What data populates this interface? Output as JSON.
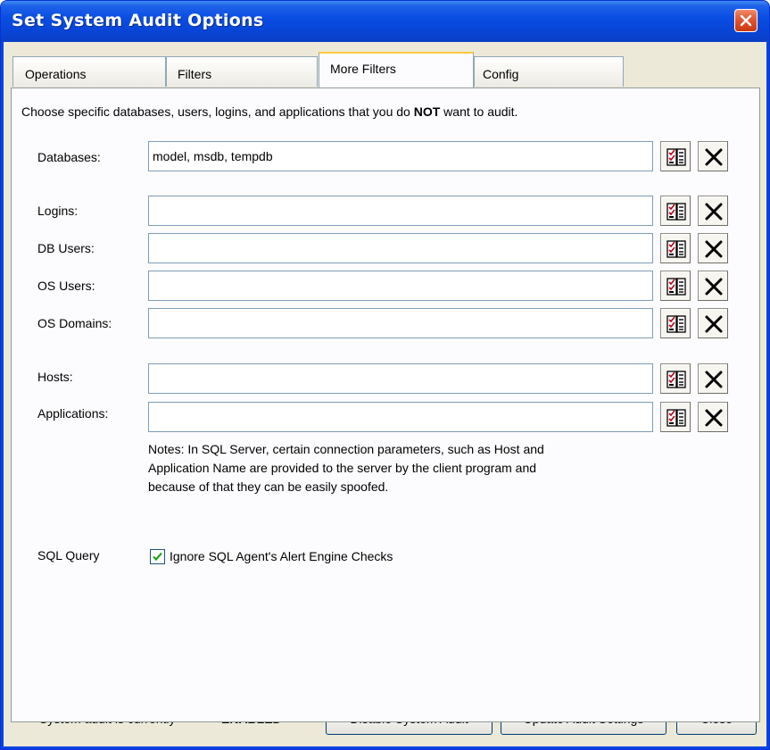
{
  "window": {
    "title": "Set System Audit Options"
  },
  "tabs": [
    {
      "label": "Operations",
      "active": false
    },
    {
      "label": "Filters",
      "active": false
    },
    {
      "label": "More Filters",
      "active": true
    },
    {
      "label": "Config",
      "active": false
    }
  ],
  "instructions": {
    "before": "Choose specific databases, users, logins, and applications that you do ",
    "strong": "NOT",
    "after": " want to audit."
  },
  "fields": [
    {
      "label": "Databases:",
      "value": "model, msdb, tempdb"
    },
    {
      "label": "Logins:",
      "value": ""
    },
    {
      "label": "DB Users:",
      "value": ""
    },
    {
      "label": "OS Users:",
      "value": ""
    },
    {
      "label": "OS Domains:",
      "value": ""
    },
    {
      "label": "Hosts:",
      "value": ""
    },
    {
      "label": "Applications:",
      "value": ""
    }
  ],
  "field_icons": {
    "select": "checklist-icon",
    "clear": "clear-x-icon"
  },
  "notes": {
    "line1": "Notes:  In SQL Server, certain connection parameters, such as Host and",
    "line2": "Application Name are provided to the server by the client program and",
    "line3": "because of that they can be easily spoofed."
  },
  "sql_query": {
    "label": "SQL Query",
    "checkbox_label": "Ignore SQL Agent's Alert Engine Checks",
    "checked": true
  },
  "status": {
    "text": "System audit is currently",
    "state": "ENABLED"
  },
  "buttons": {
    "disable": "Disable System Audit",
    "update": "Update Audit Settings",
    "close": "Close"
  },
  "colors": {
    "titlebar": "#0846d8",
    "client_bg": "#ece9d8",
    "panel_bg": "#fcfcfe",
    "tab_highlight": "#ffc83c",
    "checkmark": "#21a121"
  }
}
